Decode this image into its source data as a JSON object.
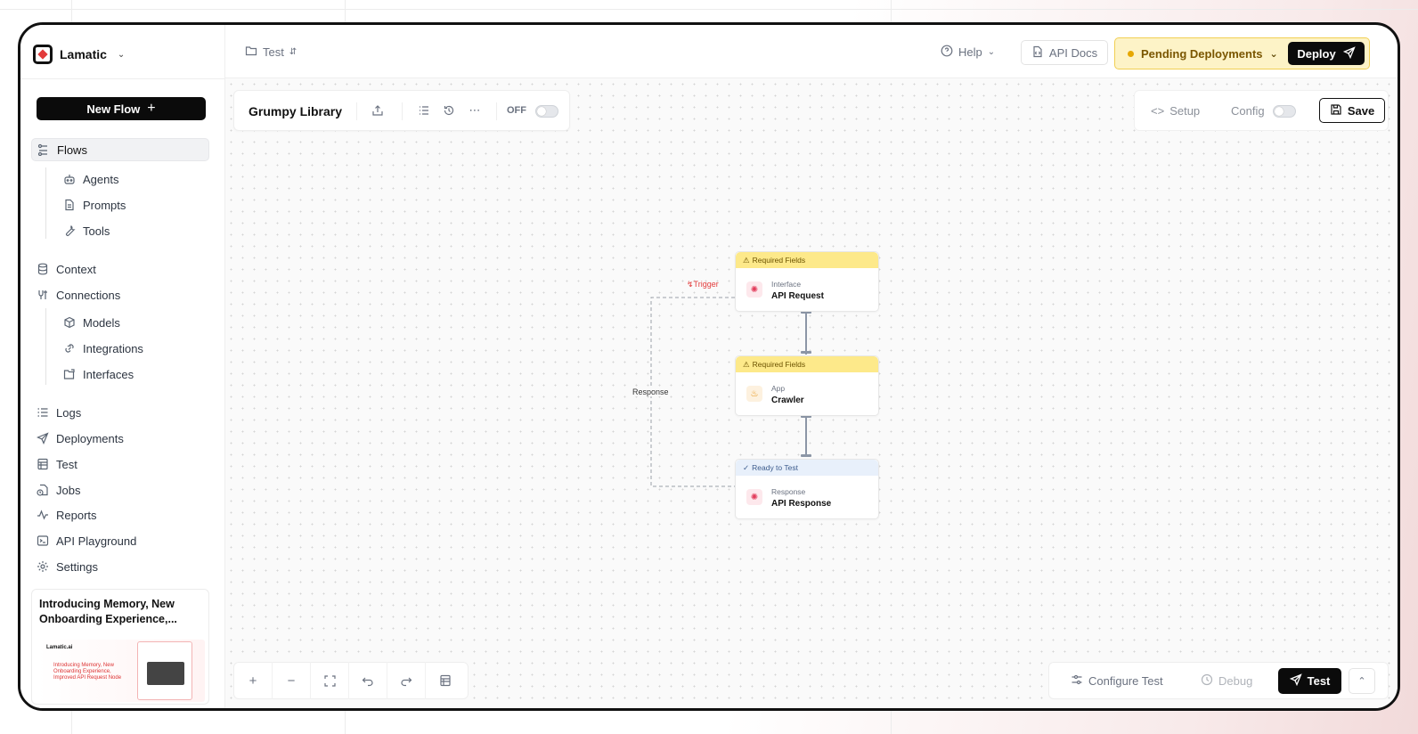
{
  "brand": {
    "name": "Lamatic"
  },
  "header": {
    "project": "Test",
    "help": "Help",
    "api_docs": "API Docs",
    "pending": "Pending Deployments",
    "deploy": "Deploy"
  },
  "sidebar": {
    "new_flow": "New Flow",
    "items": [
      {
        "label": "Flows"
      },
      {
        "label": "Agents"
      },
      {
        "label": "Prompts"
      },
      {
        "label": "Tools"
      },
      {
        "label": "Context"
      },
      {
        "label": "Connections"
      },
      {
        "label": "Models"
      },
      {
        "label": "Integrations"
      },
      {
        "label": "Interfaces"
      },
      {
        "label": "Logs"
      },
      {
        "label": "Deployments"
      },
      {
        "label": "Test"
      },
      {
        "label": "Jobs"
      },
      {
        "label": "Reports"
      },
      {
        "label": "API Playground"
      },
      {
        "label": "Settings"
      }
    ],
    "news": {
      "title": "Introducing Memory, New Onboarding Experience,...",
      "thumb_logo": "Lamatic.ai",
      "thumb_text": "Introducing Memory, New Onboarding Experience, Improved API Request Node"
    }
  },
  "canvas": {
    "flow_name": "Grumpy Library",
    "off_label": "OFF",
    "setup": "Setup",
    "config": "Config",
    "save": "Save",
    "nodes": [
      {
        "status": "Required Fields",
        "kind": "Interface",
        "title": "API Request"
      },
      {
        "status": "Required Fields",
        "kind": "App",
        "title": "Crawler"
      },
      {
        "status": "Ready to Test",
        "kind": "Response",
        "title": "API Response"
      }
    ],
    "edge_trigger": "Trigger",
    "edge_response": "Response",
    "configure_test": "Configure Test",
    "debug": "Debug",
    "test": "Test"
  },
  "colors": {
    "accent": "#0b0b0b",
    "warning": "#fde98a",
    "ready": "#e8f0fb",
    "trigger": "#e23b3b"
  }
}
